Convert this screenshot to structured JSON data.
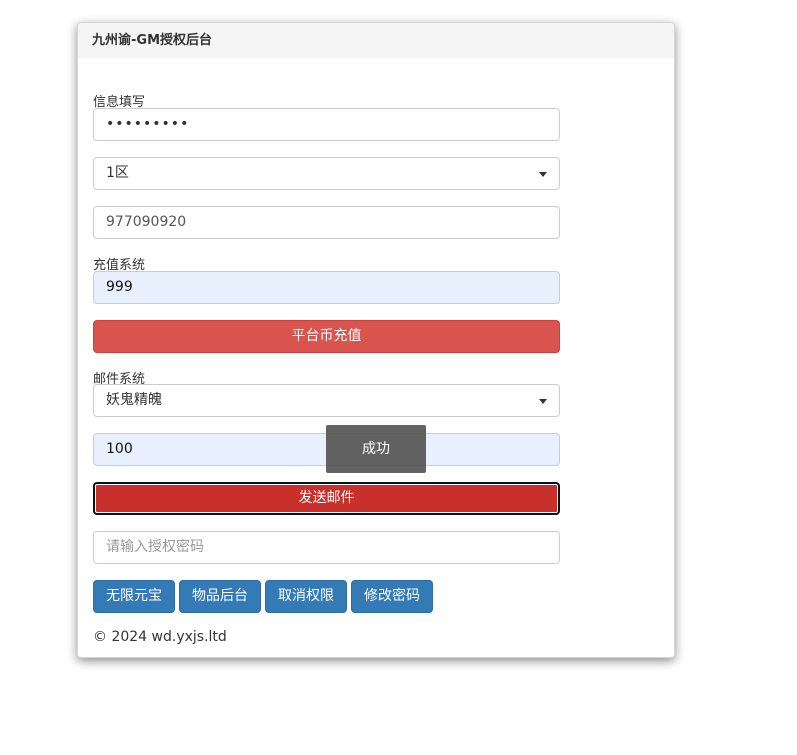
{
  "app": {
    "title": "九州谕-GM授权后台"
  },
  "info_section": {
    "label": "信息填写",
    "password_value": "•••••••••",
    "server_select": "1区",
    "account_value": "977090920"
  },
  "recharge_section": {
    "label": "充值系统",
    "amount_value": "999",
    "recharge_button": "平台币充值"
  },
  "mail_section": {
    "label": "邮件系统",
    "item_select": "妖鬼精魄",
    "quantity_value": "100",
    "send_button": "发送邮件"
  },
  "auth": {
    "password_placeholder": "请输入授权密码"
  },
  "actions": {
    "unlimited_yuanbao": "无限元宝",
    "item_backend": "物品后台",
    "cancel_permission": "取消权限",
    "change_password": "修改密码"
  },
  "footer": {
    "copyright": "© 2024 wd.yxjs.ltd"
  },
  "toast": {
    "message": "成功"
  },
  "colors": {
    "danger": "#d9534f",
    "danger_active": "#c9302c",
    "primary": "#337ab7",
    "autofill": "#e8f0fe"
  }
}
